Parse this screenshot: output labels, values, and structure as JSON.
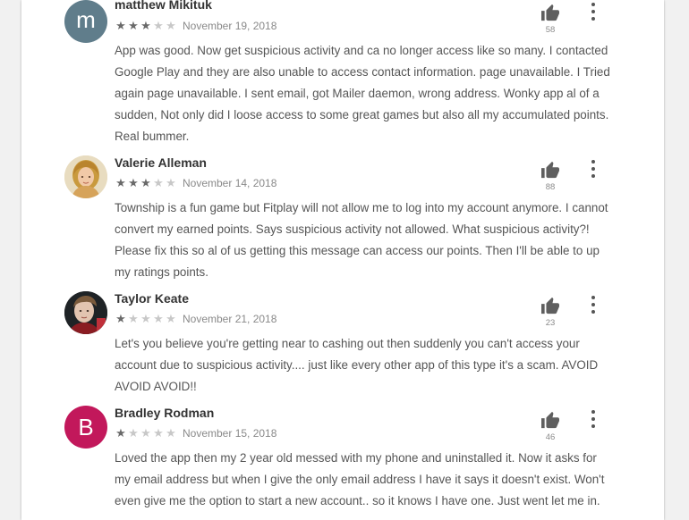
{
  "reviews": [
    {
      "author": "matthew Mikituk",
      "rating": 3,
      "max_rating": 5,
      "date": "November 19, 2018",
      "text": "App was good. Now get suspicious activity and ca no longer access like so many. I contacted Google Play and they are also unable to access contact information. page unavailable. I Tried again page unavailable. I sent email, got Mailer daemon, wrong address. Wonky app al of a sudden, Not only did I loose access to some great games but also all my accumulated points. Real bummer.",
      "helpful_count": "58",
      "avatar_letter": "m",
      "avatar_color": "#607d8b"
    },
    {
      "author": "Valerie Alleman",
      "rating": 3,
      "max_rating": 5,
      "date": "November 14, 2018",
      "text": "Township is a fun game but Fitplay will not allow me to log into my account anymore. I cannot convert my earned points. Says suspicious activity not allowed. What suspicious activity?! Please fix this so al of us getting this message can access our points. Then I'll be able to up my ratings points.",
      "helpful_count": "88",
      "avatar_letter": "",
      "avatar_color": "#c9a14a"
    },
    {
      "author": "Taylor Keate",
      "rating": 1,
      "max_rating": 5,
      "date": "November 21, 2018",
      "text": "Let's you believe you're getting near to cashing out then suddenly you can't access your account due to suspicious activity.... just like every other app of this type it's a scam. AVOID AVOID AVOID!!",
      "helpful_count": "23",
      "avatar_letter": "",
      "avatar_color": "#3a3a3a"
    },
    {
      "author": "Bradley Rodman",
      "rating": 1,
      "max_rating": 5,
      "date": "November 15, 2018",
      "text": "Loved the app then my 2 year old messed with my phone and uninstalled it. Now it asks for my email address but when I give the only email address I have it says it doesn't exist. Won't even give me the option to start a new account.. so it knows I have one. Just went let me in.",
      "helpful_count": "46",
      "avatar_letter": "B",
      "avatar_color": "#c2185b"
    }
  ],
  "icons": {
    "helpful": "thumbs-up-icon",
    "menu": "more-vert-icon"
  }
}
